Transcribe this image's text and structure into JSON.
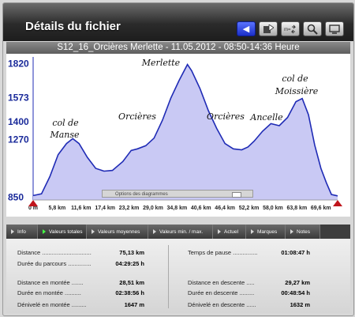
{
  "window": {
    "title": "Détails du fichier",
    "subtitle": "S12_16_Orcières Merlette - 11.05.2012 - 08:50-14:36 Heure"
  },
  "toolbar": {
    "buttons": [
      {
        "name": "back-button",
        "icon": "arrow-left-icon"
      },
      {
        "name": "export-button",
        "icon": "export-icon"
      },
      {
        "name": "sync-button",
        "icon": "sync-icon",
        "label": "m="
      },
      {
        "name": "zoom-button",
        "icon": "magnifier-icon"
      },
      {
        "name": "fullscreen-button",
        "icon": "fullscreen-icon"
      }
    ]
  },
  "chart_data": {
    "type": "area",
    "y_ticks": [
      "1820",
      "1573",
      "1400",
      "1270",
      "850"
    ],
    "x_ticks": [
      "0 m",
      "5,8 km",
      "11,6 km",
      "17,4 km",
      "23,2 km",
      "29,0 km",
      "34,8 km",
      "40,6 km",
      "46,4 km",
      "52,2 km",
      "58,0 km",
      "63,8 km",
      "69,6 km"
    ],
    "annotations": [
      "col de",
      "Manse",
      "Orcières",
      "Merlette",
      "Orcières",
      "Ancelle",
      "col de",
      "Moissière"
    ],
    "fill_color": "#c9c9f4",
    "line_color": "#1f2bb5",
    "points": [
      [
        0.0,
        862
      ],
      [
        2.0,
        875
      ],
      [
        4.0,
        1000
      ],
      [
        6.0,
        1160
      ],
      [
        8.0,
        1240
      ],
      [
        9.5,
        1276
      ],
      [
        11.0,
        1240
      ],
      [
        13.0,
        1140
      ],
      [
        15.0,
        1060
      ],
      [
        17.0,
        1040
      ],
      [
        19.0,
        1045
      ],
      [
        21.5,
        1110
      ],
      [
        23.5,
        1190
      ],
      [
        25.0,
        1202
      ],
      [
        27.0,
        1225
      ],
      [
        29.0,
        1280
      ],
      [
        31.0,
        1410
      ],
      [
        33.0,
        1570
      ],
      [
        35.0,
        1700
      ],
      [
        37.0,
        1815
      ],
      [
        38.0,
        1770
      ],
      [
        40.0,
        1640
      ],
      [
        42.0,
        1480
      ],
      [
        44.0,
        1350
      ],
      [
        46.0,
        1240
      ],
      [
        48.0,
        1202
      ],
      [
        50.0,
        1195
      ],
      [
        51.5,
        1215
      ],
      [
        53.0,
        1258
      ],
      [
        55.0,
        1330
      ],
      [
        57.0,
        1385
      ],
      [
        59.0,
        1370
      ],
      [
        61.0,
        1430
      ],
      [
        63.0,
        1545
      ],
      [
        64.5,
        1568
      ],
      [
        66.0,
        1450
      ],
      [
        67.5,
        1230
      ],
      [
        69.0,
        1060
      ],
      [
        70.3,
        955
      ],
      [
        71.5,
        870
      ],
      [
        73.0,
        860
      ]
    ],
    "xlim": [
      0,
      73
    ],
    "ylim": [
      830,
      1870
    ]
  },
  "chart_options_label": "Options des diagrammes",
  "tabs": [
    {
      "label": "Info",
      "active": false
    },
    {
      "label": "Valeurs totales",
      "active": true
    },
    {
      "label": "Valeurs moyennes",
      "active": false
    },
    {
      "label": "Valeurs min. / max.",
      "active": false
    },
    {
      "label": "Actuel",
      "active": false
    },
    {
      "label": "Marques",
      "active": false
    },
    {
      "label": "Notes",
      "active": false
    }
  ],
  "stats": {
    "distance": {
      "label": "Distance ..............................",
      "value": "75,13 km"
    },
    "duree_parcours": {
      "label": "Durée du parcours ..............",
      "value": "04:29:25 h"
    },
    "temps_pause": {
      "label": "Temps de pause ...............",
      "value": "01:08:47 h"
    },
    "distance_montee": {
      "label": "Distance en montée  .......",
      "value": "28,51 km"
    },
    "duree_montee": {
      "label": "Durée en montée  ..........",
      "value": "02:38:56 h"
    },
    "denivele_montee": {
      "label": "Dénivelé en montée .........",
      "value": "1647 m"
    },
    "distance_descente": {
      "label": "Distance en descente  .....",
      "value": "29,27 km"
    },
    "duree_descente": {
      "label": "Durée en descente  .........",
      "value": "00:48:54 h"
    },
    "denivele_descente": {
      "label": "Dénivelé en descente  ......",
      "value": "1632 m"
    }
  }
}
